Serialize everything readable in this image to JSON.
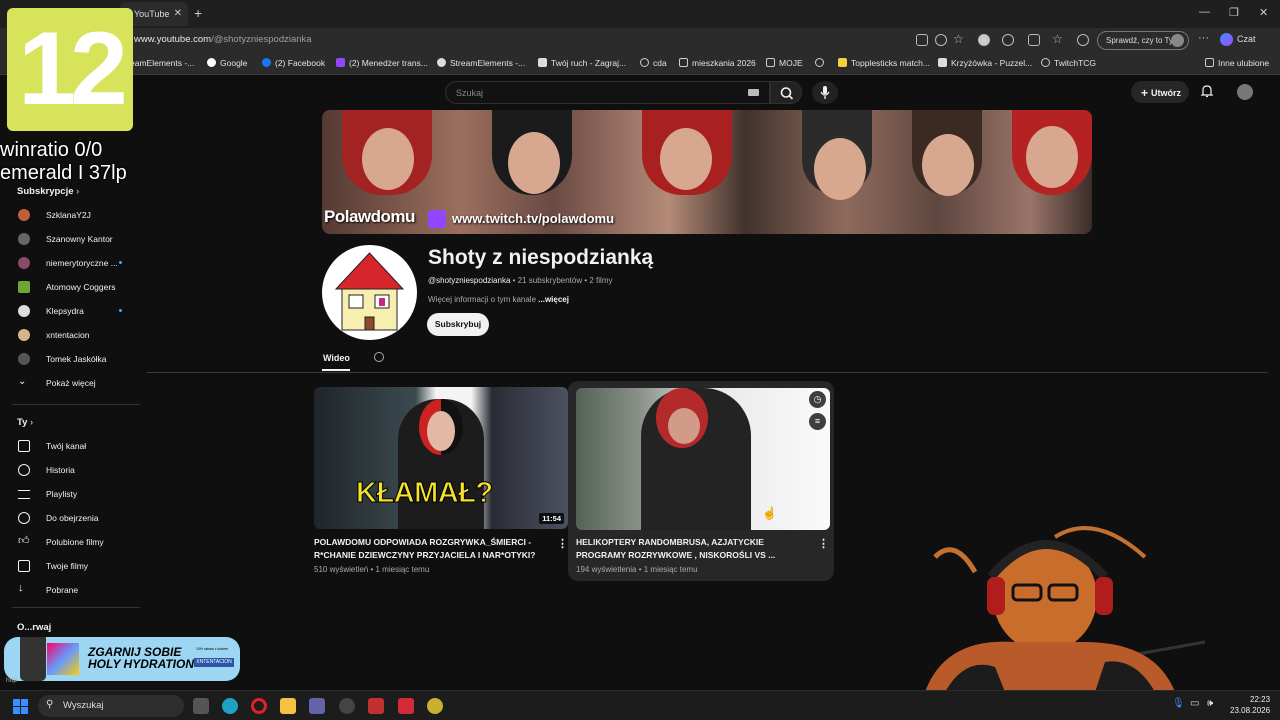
{
  "browser": {
    "tab_title": "YouTube",
    "url_prefix": "www.youtube.com",
    "url_path": "/@shotyzniespodzianka",
    "check_button": "Sprawdź, czy to Ty",
    "chat_label": "Czat",
    "other_favorites": "Inne ulubione",
    "bookmarks": [
      {
        "label": "eamElements -...",
        "icon": "streamelements-icon"
      },
      {
        "label": "Google",
        "icon": "google-icon"
      },
      {
        "label": "(2) Facebook",
        "icon": "facebook-icon"
      },
      {
        "label": "(2) Menedżer trans...",
        "icon": "twitch-icon"
      },
      {
        "label": "StreamElements -...",
        "icon": "streamelements-icon"
      },
      {
        "label": "Twój ruch - Zagraj...",
        "icon": "chess-icon"
      },
      {
        "label": "cda",
        "icon": "globe-icon"
      },
      {
        "label": "mieszkania 2026",
        "icon": "folder-icon"
      },
      {
        "label": "MOJE",
        "icon": "folder-icon"
      },
      {
        "label": "",
        "icon": "globe-icon"
      },
      {
        "label": "Topplesticks match...",
        "icon": "bookmark-icon"
      },
      {
        "label": "Krzyżówka - Puzzel...",
        "icon": "puzzle-icon"
      },
      {
        "label": "TwitchTCG",
        "icon": "globe-icon"
      }
    ]
  },
  "youtube": {
    "search_placeholder": "Szukaj",
    "create_label": "Utwórz",
    "sidebar": {
      "subscriptions_header": "Subskrypcje",
      "subscriptions": [
        {
          "label": "SzklanaY2J",
          "color": "#c0603a",
          "new": false
        },
        {
          "label": "Szanowny Kantor",
          "color": "#666666",
          "new": false
        },
        {
          "label": "niemerytoryczne ...",
          "color": "#8a4a6a",
          "new": true
        },
        {
          "label": "Atomowy Coggers",
          "color": "#6ea832",
          "new": false
        },
        {
          "label": "Klepsydra",
          "color": "#dddddd",
          "new": true
        },
        {
          "label": "xntentacion",
          "color": "#d9b48a",
          "new": false
        },
        {
          "label": "Tomek Jaskółka",
          "color": "#555555",
          "new": false
        }
      ],
      "show_more": "Pokaż więcej",
      "you_header": "Ty",
      "you_items": [
        {
          "label": "Twój kanał",
          "icon": "account-box-icon"
        },
        {
          "label": "Historia",
          "icon": "history-icon"
        },
        {
          "label": "Playlisty",
          "icon": "playlist-icon"
        },
        {
          "label": "Do obejrzenia",
          "icon": "clock-icon"
        },
        {
          "label": "Polubione filmy",
          "icon": "thumb-up-icon"
        },
        {
          "label": "Twoje filmy",
          "icon": "video-icon"
        },
        {
          "label": "Pobrane",
          "icon": "download-icon"
        }
      ],
      "explore_partial": "O...rwaj"
    },
    "channel": {
      "banner_name": "Polawdomu",
      "banner_url": "www.twitch.tv/polawdomu",
      "name": "Shoty z niespodzianką",
      "handle": "@shotyzniespodzianka",
      "subscribers": "21 subskrybentów",
      "videos_count": "2 filmy",
      "description": "Więcej informacji o tym kanale",
      "more": "...więcej",
      "subscribe": "Subskrybuj",
      "tab_videos": "Wideo"
    },
    "videos": [
      {
        "title_line1": "POLAWDOMU ODPOWIADA ROZGRYWKA_ŚMIERCI -",
        "title_line2": "R*CHANIE DZIEWCZYNY PRZYJACIELA I NAR*OTYKI?",
        "views": "510 wyświetleń",
        "age": "1 miesiąc temu",
        "duration": "11:54",
        "thumb_text": "KŁAMAŁ?"
      },
      {
        "title_line1": "HELIKOPTERY RANDOMBRUSA, AZJATYCKIE",
        "title_line2": "PROGRAMY ROZRYWKOWE , NISKOROŚLI VS ...",
        "views": "194 wyświetlenia",
        "age": "1 miesiąc temu"
      }
    ]
  },
  "overlay": {
    "number": "12",
    "line1": "winratio 0/0",
    "line2": "emerald I 37lp",
    "promo_line1": "ZGARNIJ SOBIE",
    "promo_line2": "HOLY HYDRATION",
    "promo_badge": "XNTENTACION",
    "promo_small": "10% rabatu z kodem",
    "status_url": "http"
  },
  "taskbar": {
    "search": "Wyszukaj",
    "time": "22:23",
    "date": "23.08.2026"
  }
}
